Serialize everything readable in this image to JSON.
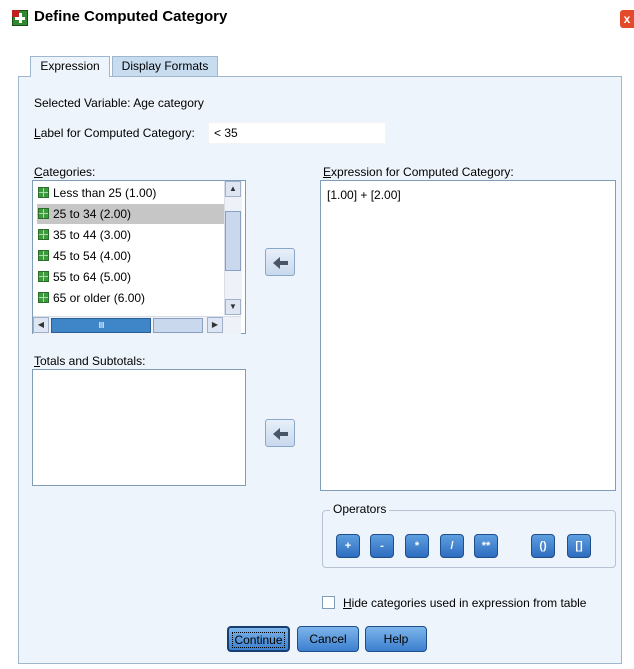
{
  "window": {
    "title": "Define Computed Category",
    "close_label": "x"
  },
  "tabs": [
    {
      "label": "Expression",
      "active": true
    },
    {
      "label": "Display Formats",
      "active": false
    }
  ],
  "selected_variable": {
    "prefix": "Selected Variable: ",
    "value": "Age category"
  },
  "label_field": {
    "mnemonic": "L",
    "label_rest": "abel for Computed Category:",
    "value": "< 35"
  },
  "categories": {
    "mnemonic": "C",
    "label_rest": "ategories:",
    "items": [
      {
        "text": "Less than 25 (1.00)",
        "selected": false
      },
      {
        "text": "25 to 34 (2.00)",
        "selected": true
      },
      {
        "text": "35 to 44 (3.00)",
        "selected": false
      },
      {
        "text": "45 to 54 (4.00)",
        "selected": false
      },
      {
        "text": "55 to 64 (5.00)",
        "selected": false
      },
      {
        "text": "65 or older (6.00)",
        "selected": false
      }
    ]
  },
  "totals": {
    "mnemonic": "T",
    "label_rest": "otals and Subtotals:"
  },
  "expression": {
    "mnemonic": "E",
    "label_rest": "xpression for Computed Category:",
    "value": "[1.00] + [2.00]"
  },
  "operators": {
    "legend": "Operators",
    "buttons": [
      "+",
      "-",
      "*",
      "/",
      "**",
      "()",
      "[]"
    ]
  },
  "hide_checkbox": {
    "mnemonic": "H",
    "label_rest": "ide categories used in expression from table",
    "checked": false
  },
  "buttons": {
    "continue": "Continue",
    "cancel": "Cancel",
    "help": "Help"
  },
  "colors": {
    "panel": "#eef4fb",
    "button_blue": "#3c7fcf",
    "selection": "#c6c6c6"
  }
}
